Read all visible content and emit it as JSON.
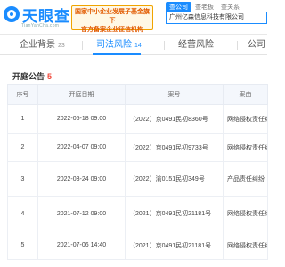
{
  "header": {
    "logo_text": "天眼查",
    "logo_url": "TianYanCha.com",
    "promo_line1": "国家中小企业发展子基金旗下",
    "promo_line2": "官方备案企业征信机构",
    "search_tabs": [
      "查公司",
      "查老板",
      "查关系"
    ],
    "search_value": "广州亿森信息科技有限公司"
  },
  "tabs": [
    {
      "label": "企业背景",
      "count": "23"
    },
    {
      "label": "司法风险",
      "count": "14"
    },
    {
      "label": "经营风险",
      "count": ""
    },
    {
      "label": "公司",
      "count": ""
    }
  ],
  "section": {
    "title": "开庭公告",
    "count": "5"
  },
  "table": {
    "headers": [
      "序号",
      "开庭日期",
      "案号",
      "案由"
    ],
    "rows": [
      {
        "no": "1",
        "date": "2022-05-18 09:00",
        "case": "（2022）京0491民初8360号",
        "reason": "网络侵权责任纠纷"
      },
      {
        "no": "2",
        "date": "2022-04-07 09:00",
        "case": "（2022）京0491民初9733号",
        "reason": "网络侵权责任纠纷"
      },
      {
        "no": "3",
        "date": "2022-03-24 09:00",
        "case": "（2022）渝0151民初349号",
        "reason": "产品责任纠纷"
      },
      {
        "no": "4",
        "date": "2021-07-12 09:00",
        "case": "（2021）京0491民初21181号",
        "reason": "网络侵权责任纠纷"
      },
      {
        "no": "5",
        "date": "2021-07-06 14:40",
        "case": "（2021）京0491民初21181号",
        "reason": "网络侵权责任纠纷"
      }
    ]
  }
}
